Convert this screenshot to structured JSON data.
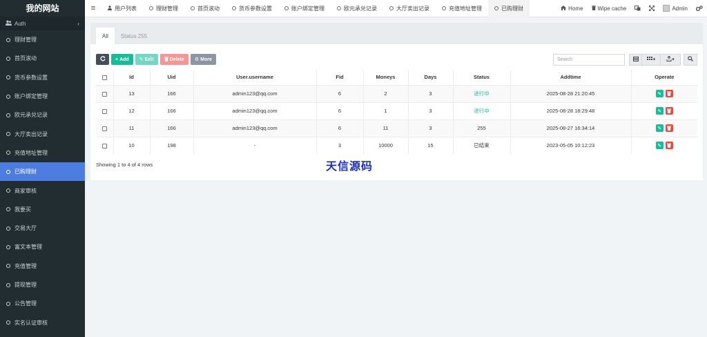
{
  "sidebar": {
    "brand": "我的网站",
    "auth_label": "Auth",
    "collapse_glyph": "‹",
    "items": [
      {
        "label": "理财管理",
        "active": false
      },
      {
        "label": "首页滚动",
        "active": false
      },
      {
        "label": "货币参数设置",
        "active": false
      },
      {
        "label": "账户绑定管理",
        "active": false
      },
      {
        "label": "欧元承兑记录",
        "active": false
      },
      {
        "label": "大厅卖出记录",
        "active": false
      },
      {
        "label": "充值地址管理",
        "active": false
      },
      {
        "label": "已购理财",
        "active": true
      },
      {
        "label": "商家审核",
        "active": false
      },
      {
        "label": "我要买",
        "active": false
      },
      {
        "label": "交易大厅",
        "active": false
      },
      {
        "label": "富文本管理",
        "active": false
      },
      {
        "label": "充值管理",
        "active": false
      },
      {
        "label": "提现管理",
        "active": false
      },
      {
        "label": "公告管理",
        "active": false
      },
      {
        "label": "实名认证审核",
        "active": false
      }
    ]
  },
  "topnav": {
    "hamburger": "≡",
    "tabs": [
      {
        "label": "用户列表",
        "icon": "user-icon",
        "active": false
      },
      {
        "label": "理财管理",
        "icon": "circle-icon",
        "active": false
      },
      {
        "label": "首页滚动",
        "icon": "circle-icon",
        "active": false
      },
      {
        "label": "货币参数设置",
        "icon": "circle-icon",
        "active": false
      },
      {
        "label": "账户绑定管理",
        "icon": "circle-icon",
        "active": false
      },
      {
        "label": "欧元承兑记录",
        "icon": "circle-icon",
        "active": false
      },
      {
        "label": "大厅卖出记录",
        "icon": "circle-icon",
        "active": false
      },
      {
        "label": "充值地址管理",
        "icon": "circle-icon",
        "active": false
      },
      {
        "label": "已购理财",
        "icon": "circle-icon",
        "active": true
      }
    ],
    "home_label": "Home",
    "wipe_label": "Wipe cache",
    "admin_label": "Admin"
  },
  "panel": {
    "tabs": [
      {
        "label": "All",
        "active": true
      },
      {
        "label": "Status 255",
        "active": false
      }
    ]
  },
  "toolbar": {
    "add_label": "Add",
    "edit_label": "Edit",
    "delete_label": "Delete",
    "more_label": "More",
    "search_placeholder": "Search"
  },
  "table": {
    "columns": [
      "Id",
      "Uid",
      "User.username",
      "Fid",
      "Moneys",
      "Days",
      "Status",
      "Addtime",
      "Operate"
    ],
    "rows": [
      {
        "id": "13",
        "uid": "166",
        "username": "admin123@qq.com",
        "fid": "6",
        "moneys": "2",
        "days": "3",
        "status": "进行中",
        "status_color": "#18bc9c",
        "addtime": "2025-08-28 21:20:45"
      },
      {
        "id": "12",
        "uid": "166",
        "username": "admin123@qq.com",
        "fid": "6",
        "moneys": "1",
        "days": "3",
        "status": "进行中",
        "status_color": "#18bc9c",
        "addtime": "2025-08-28 18:29:48"
      },
      {
        "id": "11",
        "uid": "166",
        "username": "admin123@qq.com",
        "fid": "6",
        "moneys": "11",
        "days": "3",
        "status": "255",
        "status_color": "#333333",
        "addtime": "2025-08-27 16:34:14"
      },
      {
        "id": "10",
        "uid": "198",
        "username": "-",
        "fid": "3",
        "moneys": "10000",
        "days": "15",
        "status": "已结束",
        "status_color": "#333333",
        "addtime": "2023-05-05 10:12:23"
      }
    ]
  },
  "footer": {
    "showing_text": "Showing 1 to 4 of 4 rows"
  },
  "watermark": "天信源码",
  "colors": {
    "sidebar_bg": "#222d32",
    "active_blue": "#4e7de2",
    "success": "#18bc9c",
    "danger": "#e74c3c"
  }
}
